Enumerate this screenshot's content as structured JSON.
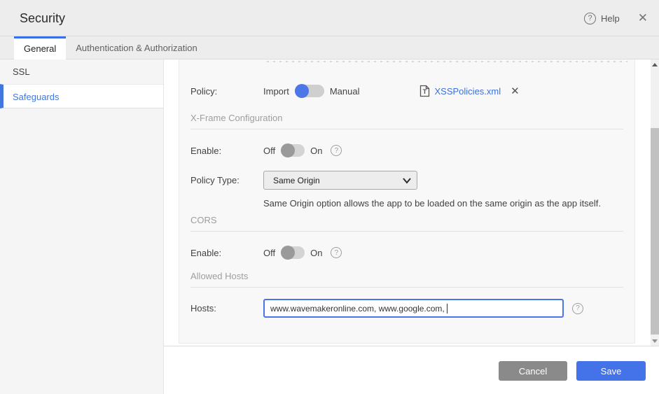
{
  "header": {
    "title": "Security",
    "help": "Help"
  },
  "tabs": {
    "general": "General",
    "auth": "Authentication & Authorization"
  },
  "sidebar": {
    "ssl": "SSL",
    "safeguards": "Safeguards"
  },
  "xss": {
    "policy_label": "Policy:",
    "import": "Import",
    "manual": "Manual",
    "selected_mode": "Import",
    "file_name": "XSSPolicies.xml"
  },
  "xframe": {
    "title": "X-Frame Configuration",
    "enable_label": "Enable:",
    "off": "Off",
    "on": "On",
    "enable_value": "Off",
    "policy_type_label": "Policy Type:",
    "policy_type_value": "Same Origin",
    "description": "Same Origin option allows the app to be loaded on the same origin as the app itself."
  },
  "cors": {
    "title": "CORS",
    "enable_label": "Enable:",
    "off": "Off",
    "on": "On",
    "enable_value": "Off"
  },
  "allowed_hosts": {
    "title": "Allowed Hosts",
    "hosts_label": "Hosts:",
    "hosts_value": "www.wavemakeronline.com, www.google.com, "
  },
  "footer": {
    "cancel": "Cancel",
    "save": "Save"
  },
  "colors": {
    "accent_blue": "#4472e8",
    "link_blue": "#3b6fe0",
    "toggle_on_blue": "#4d76e8",
    "selected_nav_blue": "#4277e0",
    "cancel_gray": "#8a8a8a"
  }
}
